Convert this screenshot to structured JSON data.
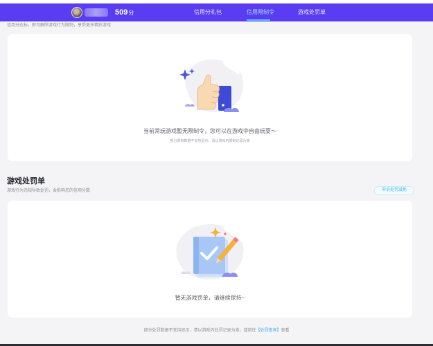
{
  "header": {
    "score": "509",
    "score_unit": "分",
    "tabs": [
      {
        "label": "信用分礼包",
        "active": false
      },
      {
        "label": "信用限制令",
        "active": true
      },
      {
        "label": "游戏处罚单",
        "active": false
      }
    ]
  },
  "restriction": {
    "hint": "信用分达标，即可解除游戏行为限制，享受更多精彩游戏",
    "message": "当前常玩游戏暂无限制令，您可以在游戏中自由玩耍～",
    "sub_note": "部分限制数据不支持显示，请以游戏内限制记录为准"
  },
  "penalty": {
    "title": "游戏处罚单",
    "description": "游戏行为违规导致处罚，会影响您的信用分数",
    "appeal_button": "申诉处罚减免",
    "message": "暂无游戏罚单，请继续保持~"
  },
  "footer": {
    "text_before": "部分处罚数据不支持显示，请以游戏内处罚记录为准，或前往",
    "link": "【处罚查询】",
    "text_after": "查看"
  },
  "colors": {
    "nav_bg": "#5a3df2",
    "accent": "#35b5ff",
    "page_bg": "#f4f4f6",
    "card_bg": "#ffffff"
  },
  "icons": [
    "avatar",
    "thumbs-up-illustration",
    "clipboard-pencil-illustration"
  ]
}
